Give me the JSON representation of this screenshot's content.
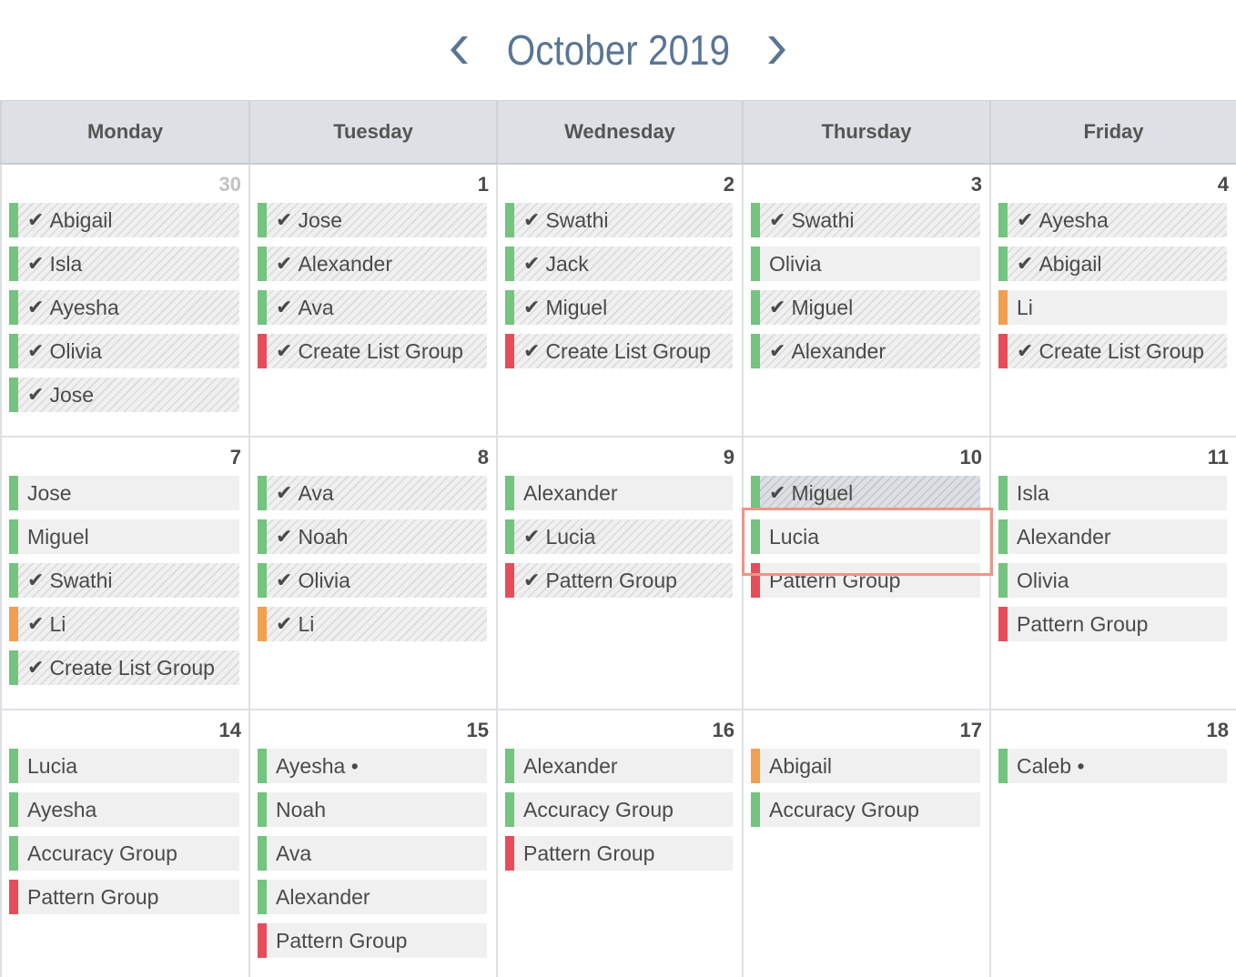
{
  "header": {
    "title": "October 2019",
    "prev_icon": "chevron-left-icon",
    "next_icon": "chevron-right-icon"
  },
  "colors": {
    "accent": "#5a7594",
    "green": "#72c47e",
    "red": "#e74c5a",
    "orange": "#f0a050",
    "highlight": "#ef9486"
  },
  "weekdays": [
    "Monday",
    "Tuesday",
    "Wednesday",
    "Thursday",
    "Friday"
  ],
  "weeks": [
    {
      "days": [
        {
          "num": "30",
          "other_month": true,
          "events": [
            {
              "label": "Abigail",
              "done": true,
              "color": "green"
            },
            {
              "label": "Isla",
              "done": true,
              "color": "green"
            },
            {
              "label": "Ayesha",
              "done": true,
              "color": "green"
            },
            {
              "label": "Olivia",
              "done": true,
              "color": "green"
            },
            {
              "label": "Jose",
              "done": true,
              "color": "green"
            }
          ]
        },
        {
          "num": "1",
          "events": [
            {
              "label": "Jose",
              "done": true,
              "color": "green"
            },
            {
              "label": "Alexander",
              "done": true,
              "color": "green"
            },
            {
              "label": "Ava",
              "done": true,
              "color": "green"
            },
            {
              "label": "Create List Group",
              "done": true,
              "color": "red"
            }
          ]
        },
        {
          "num": "2",
          "events": [
            {
              "label": "Swathi",
              "done": true,
              "color": "green"
            },
            {
              "label": "Jack",
              "done": true,
              "color": "green"
            },
            {
              "label": "Miguel",
              "done": true,
              "color": "green"
            },
            {
              "label": "Create List Group",
              "done": true,
              "color": "red"
            }
          ]
        },
        {
          "num": "3",
          "events": [
            {
              "label": "Swathi",
              "done": true,
              "color": "green"
            },
            {
              "label": "Olivia",
              "done": false,
              "color": "green"
            },
            {
              "label": "Miguel",
              "done": true,
              "color": "green"
            },
            {
              "label": "Alexander",
              "done": true,
              "color": "green"
            }
          ]
        },
        {
          "num": "4",
          "events": [
            {
              "label": "Ayesha",
              "done": true,
              "color": "green"
            },
            {
              "label": "Abigail",
              "done": true,
              "color": "green"
            },
            {
              "label": "Li",
              "done": false,
              "color": "orange"
            },
            {
              "label": "Create List Group",
              "done": true,
              "color": "red"
            }
          ]
        }
      ]
    },
    {
      "days": [
        {
          "num": "7",
          "events": [
            {
              "label": "Jose",
              "done": false,
              "color": "green"
            },
            {
              "label": "Miguel",
              "done": false,
              "color": "green"
            },
            {
              "label": "Swathi",
              "done": true,
              "color": "green"
            },
            {
              "label": "Li",
              "done": true,
              "color": "orange"
            },
            {
              "label": "Create List Group",
              "done": true,
              "color": "green"
            }
          ]
        },
        {
          "num": "8",
          "events": [
            {
              "label": "Ava",
              "done": true,
              "color": "green"
            },
            {
              "label": "Noah",
              "done": true,
              "color": "green"
            },
            {
              "label": "Olivia",
              "done": true,
              "color": "green"
            },
            {
              "label": "Li",
              "done": true,
              "color": "orange"
            }
          ]
        },
        {
          "num": "9",
          "events": [
            {
              "label": "Alexander",
              "done": false,
              "color": "green"
            },
            {
              "label": "Lucia",
              "done": true,
              "color": "green"
            },
            {
              "label": "Pattern Group",
              "done": true,
              "color": "red"
            }
          ]
        },
        {
          "num": "10",
          "events": [
            {
              "label": "Miguel",
              "done": true,
              "color": "green",
              "active": true
            },
            {
              "label": "Lucia",
              "done": false,
              "color": "green",
              "highlighted": true
            },
            {
              "label": "Pattern Group",
              "done": false,
              "color": "red"
            }
          ]
        },
        {
          "num": "11",
          "events": [
            {
              "label": "Isla",
              "done": false,
              "color": "green"
            },
            {
              "label": "Alexander",
              "done": false,
              "color": "green"
            },
            {
              "label": "Olivia",
              "done": false,
              "color": "green"
            },
            {
              "label": "Pattern Group",
              "done": false,
              "color": "red"
            }
          ]
        }
      ]
    },
    {
      "days": [
        {
          "num": "14",
          "events": [
            {
              "label": "Lucia",
              "done": false,
              "color": "green"
            },
            {
              "label": "Ayesha",
              "done": false,
              "color": "green"
            },
            {
              "label": "Accuracy Group",
              "done": false,
              "color": "green"
            },
            {
              "label": "Pattern Group",
              "done": false,
              "color": "red"
            }
          ]
        },
        {
          "num": "15",
          "events": [
            {
              "label": "Ayesha •",
              "done": false,
              "color": "green"
            },
            {
              "label": "Noah",
              "done": false,
              "color": "green"
            },
            {
              "label": "Ava",
              "done": false,
              "color": "green"
            },
            {
              "label": "Alexander",
              "done": false,
              "color": "green"
            },
            {
              "label": "Pattern Group",
              "done": false,
              "color": "red"
            }
          ]
        },
        {
          "num": "16",
          "events": [
            {
              "label": "Alexander",
              "done": false,
              "color": "green"
            },
            {
              "label": "Accuracy Group",
              "done": false,
              "color": "green"
            },
            {
              "label": "Pattern Group",
              "done": false,
              "color": "red"
            }
          ]
        },
        {
          "num": "17",
          "events": [
            {
              "label": "Abigail",
              "done": false,
              "color": "orange"
            },
            {
              "label": "Accuracy Group",
              "done": false,
              "color": "green"
            }
          ]
        },
        {
          "num": "18",
          "events": [
            {
              "label": "Caleb •",
              "done": false,
              "color": "green"
            }
          ]
        }
      ]
    }
  ]
}
